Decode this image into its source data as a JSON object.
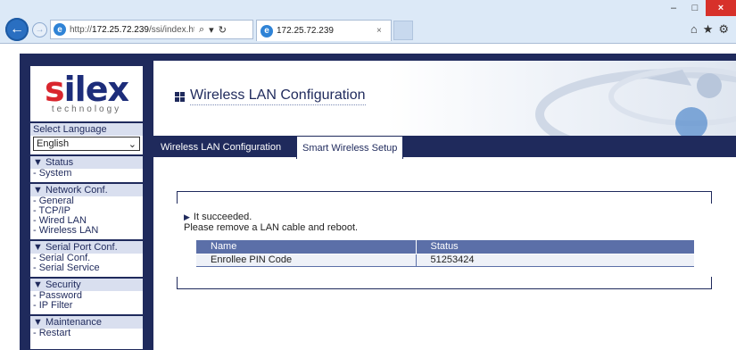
{
  "browser": {
    "address_prefix": "http://",
    "address_host": "172.25.72.239",
    "address_path": "/ssi/index.htm?pa;",
    "tab_title": "172.25.72.239",
    "window_buttons": [
      "–",
      "□",
      "×"
    ]
  },
  "sidebar": {
    "logo_main_red": "s",
    "logo_main_rest": "ilex",
    "logo_sub": "technology",
    "language_label": "Select Language",
    "language_value": "English",
    "sections": [
      {
        "title": "▼ Status",
        "items": [
          "- System"
        ]
      },
      {
        "title": "▼ Network Conf.",
        "items": [
          "- General",
          "- TCP/IP",
          "- Wired LAN",
          "- Wireless LAN"
        ]
      },
      {
        "title": "▼ Serial Port Conf.",
        "items": [
          "- Serial Conf.",
          "- Serial Service"
        ]
      },
      {
        "title": "▼ Security",
        "items": [
          "- Password",
          "- IP Filter"
        ]
      },
      {
        "title": "▼ Maintenance",
        "items": [
          "- Restart"
        ]
      }
    ]
  },
  "main": {
    "page_title": "Wireless LAN Configuration",
    "tabs": [
      {
        "label": "Wireless LAN Configuration",
        "active": false
      },
      {
        "label": "Smart Wireless Setup",
        "active": true
      }
    ],
    "message_line1": "It succeeded.",
    "message_line2": "Please remove a LAN cable and reboot.",
    "table": {
      "headers": [
        "Name",
        "Status"
      ],
      "rows": [
        [
          "Enrollee PIN Code",
          "51253424"
        ]
      ]
    }
  },
  "colors": {
    "navy": "#1f2a5c",
    "accent_red": "#d9262e",
    "table_header": "#5b6fa8"
  }
}
